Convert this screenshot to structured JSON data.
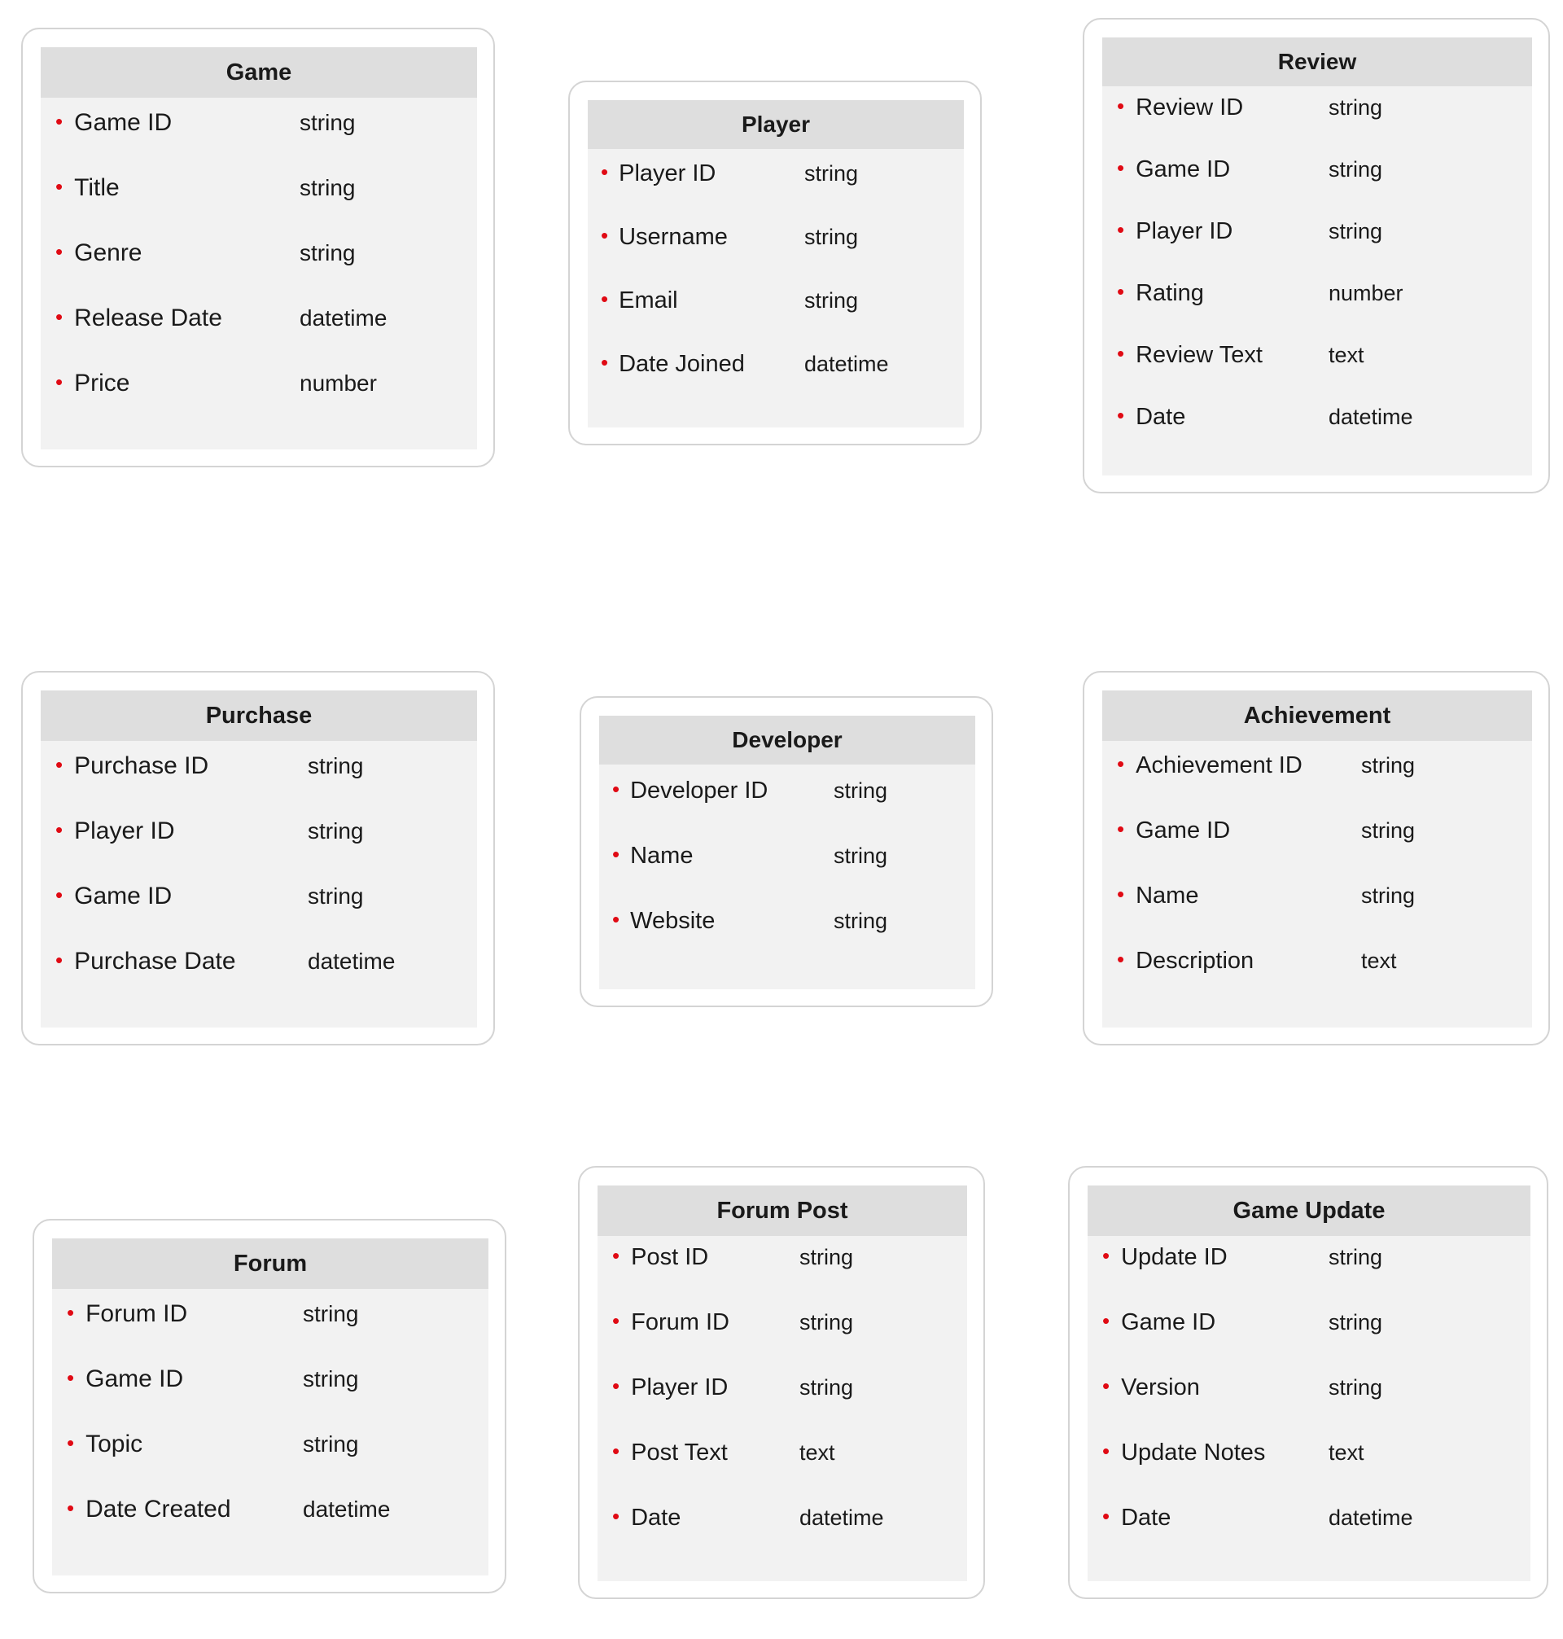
{
  "diagram": {
    "type": "entity-relationship-diagram",
    "background_color": "#ffffff",
    "bullet_color": "#e00a14",
    "header_band_color": "#dedede",
    "panel_body_color": "#f2f2f2",
    "card_border_color": "#d4d4d4",
    "bullet_glyph": "•",
    "entities": [
      {
        "id": "game",
        "title": "Game",
        "attributes": [
          {
            "name": "Game ID",
            "type": "string"
          },
          {
            "name": "Title",
            "type": "string"
          },
          {
            "name": "Genre",
            "type": "string"
          },
          {
            "name": "Release Date",
            "type": "datetime"
          },
          {
            "name": "Price",
            "type": "number"
          }
        ]
      },
      {
        "id": "player",
        "title": "Player",
        "attributes": [
          {
            "name": "Player ID",
            "type": "string"
          },
          {
            "name": "Username",
            "type": "string"
          },
          {
            "name": "Email",
            "type": "string"
          },
          {
            "name": "Date Joined",
            "type": "datetime"
          }
        ]
      },
      {
        "id": "review",
        "title": "Review",
        "attributes": [
          {
            "name": "Review ID",
            "type": "string"
          },
          {
            "name": "Game ID",
            "type": "string"
          },
          {
            "name": "Player ID",
            "type": "string"
          },
          {
            "name": "Rating",
            "type": "number"
          },
          {
            "name": "Review Text",
            "type": "text"
          },
          {
            "name": "Date",
            "type": "datetime"
          }
        ]
      },
      {
        "id": "purchase",
        "title": "Purchase",
        "attributes": [
          {
            "name": "Purchase ID",
            "type": "string"
          },
          {
            "name": "Player ID",
            "type": "string"
          },
          {
            "name": "Game ID",
            "type": "string"
          },
          {
            "name": "Purchase Date",
            "type": "datetime"
          }
        ]
      },
      {
        "id": "developer",
        "title": "Developer",
        "attributes": [
          {
            "name": "Developer ID",
            "type": "string"
          },
          {
            "name": "Name",
            "type": "string"
          },
          {
            "name": "Website",
            "type": "string"
          }
        ]
      },
      {
        "id": "achievement",
        "title": "Achievement",
        "attributes": [
          {
            "name": "Achievement ID",
            "type": "string"
          },
          {
            "name": "Game ID",
            "type": "string"
          },
          {
            "name": "Name",
            "type": "string"
          },
          {
            "name": "Description",
            "type": "text"
          }
        ]
      },
      {
        "id": "forum",
        "title": "Forum",
        "attributes": [
          {
            "name": "Forum ID",
            "type": "string"
          },
          {
            "name": "Game ID",
            "type": "string"
          },
          {
            "name": "Topic",
            "type": "string"
          },
          {
            "name": "Date Created",
            "type": "datetime"
          }
        ]
      },
      {
        "id": "forumpost",
        "title": "Forum Post",
        "attributes": [
          {
            "name": "Post ID",
            "type": "string"
          },
          {
            "name": "Forum ID",
            "type": "string"
          },
          {
            "name": "Player ID",
            "type": "string"
          },
          {
            "name": "Post Text",
            "type": "text"
          },
          {
            "name": "Date",
            "type": "datetime"
          }
        ]
      },
      {
        "id": "gameupdate",
        "title": "Game Update",
        "attributes": [
          {
            "name": "Update ID",
            "type": "string"
          },
          {
            "name": "Game ID",
            "type": "string"
          },
          {
            "name": "Version",
            "type": "string"
          },
          {
            "name": "Update Notes",
            "type": "text"
          },
          {
            "name": "Date",
            "type": "datetime"
          }
        ]
      }
    ]
  }
}
